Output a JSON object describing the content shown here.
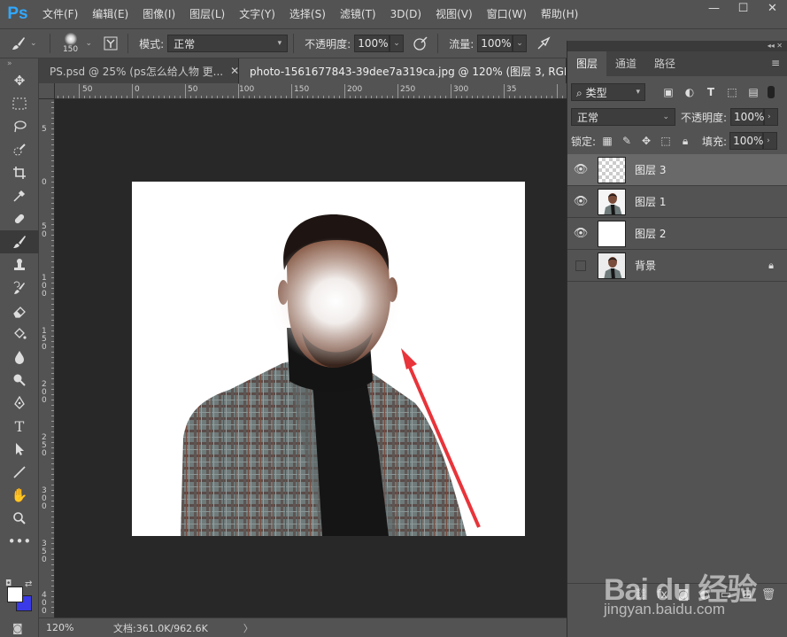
{
  "app": {
    "logo": "Ps"
  },
  "menu": [
    "文件(F)",
    "编辑(E)",
    "图像(I)",
    "图层(L)",
    "文字(Y)",
    "选择(S)",
    "滤镜(T)",
    "3D(D)",
    "视图(V)",
    "窗口(W)",
    "帮助(H)"
  ],
  "window_controls": {
    "minimize": "—",
    "maximize": "☐",
    "close": "✕"
  },
  "options": {
    "brush_size": "150",
    "mode_label": "模式:",
    "mode_value": "正常",
    "opacity_label": "不透明度:",
    "opacity_value": "100%",
    "flow_label": "流量:",
    "flow_value": "100%"
  },
  "tabs": [
    {
      "label": "PS.psd @ 25% (ps怎么给人物 更...",
      "close": "✕"
    },
    {
      "label": "photo-1561677843-39dee7a319ca.jpg @ 120% (图层 3, RGB/8) *",
      "close": "✕"
    }
  ],
  "ruler_top_labels": [
    "50",
    "0",
    "50",
    "100",
    "150",
    "200",
    "250",
    "300",
    "35"
  ],
  "ruler_left_labels": [
    "5",
    "0",
    "5\n0",
    "1\n0\n0",
    "1\n5\n0",
    "2\n0\n0",
    "2\n5\n0",
    "3\n0\n0",
    "3\n5\n0",
    "4\n0\n0",
    "4\n5\n0",
    "5"
  ],
  "status": {
    "zoom": "120%",
    "doc_info": "文档:361.0K/962.6K",
    "arrow": "〉"
  },
  "panel": {
    "tabs": [
      "图层",
      "通道",
      "路径"
    ],
    "filter_label": "类型",
    "blend_mode": "正常",
    "opacity_label": "不透明度:",
    "opacity_value": "100%",
    "lock_label": "锁定:",
    "fill_label": "填充:",
    "fill_value": "100%",
    "layers": [
      {
        "name": "图层 3",
        "visible": true,
        "selected": true,
        "thumb": "transparent"
      },
      {
        "name": "图层 1",
        "visible": true,
        "selected": false,
        "thumb": "photo"
      },
      {
        "name": "图层 2",
        "visible": true,
        "selected": false,
        "thumb": "white"
      },
      {
        "name": "背景",
        "visible": false,
        "selected": false,
        "thumb": "photo",
        "locked": true
      }
    ]
  },
  "watermark": {
    "logo": "Bai du 经验",
    "url": "jingyan.baidu.com"
  },
  "colors": {
    "foreground": "#ffffff",
    "background": "#3a3ae8",
    "arrow": "#e8343a"
  }
}
